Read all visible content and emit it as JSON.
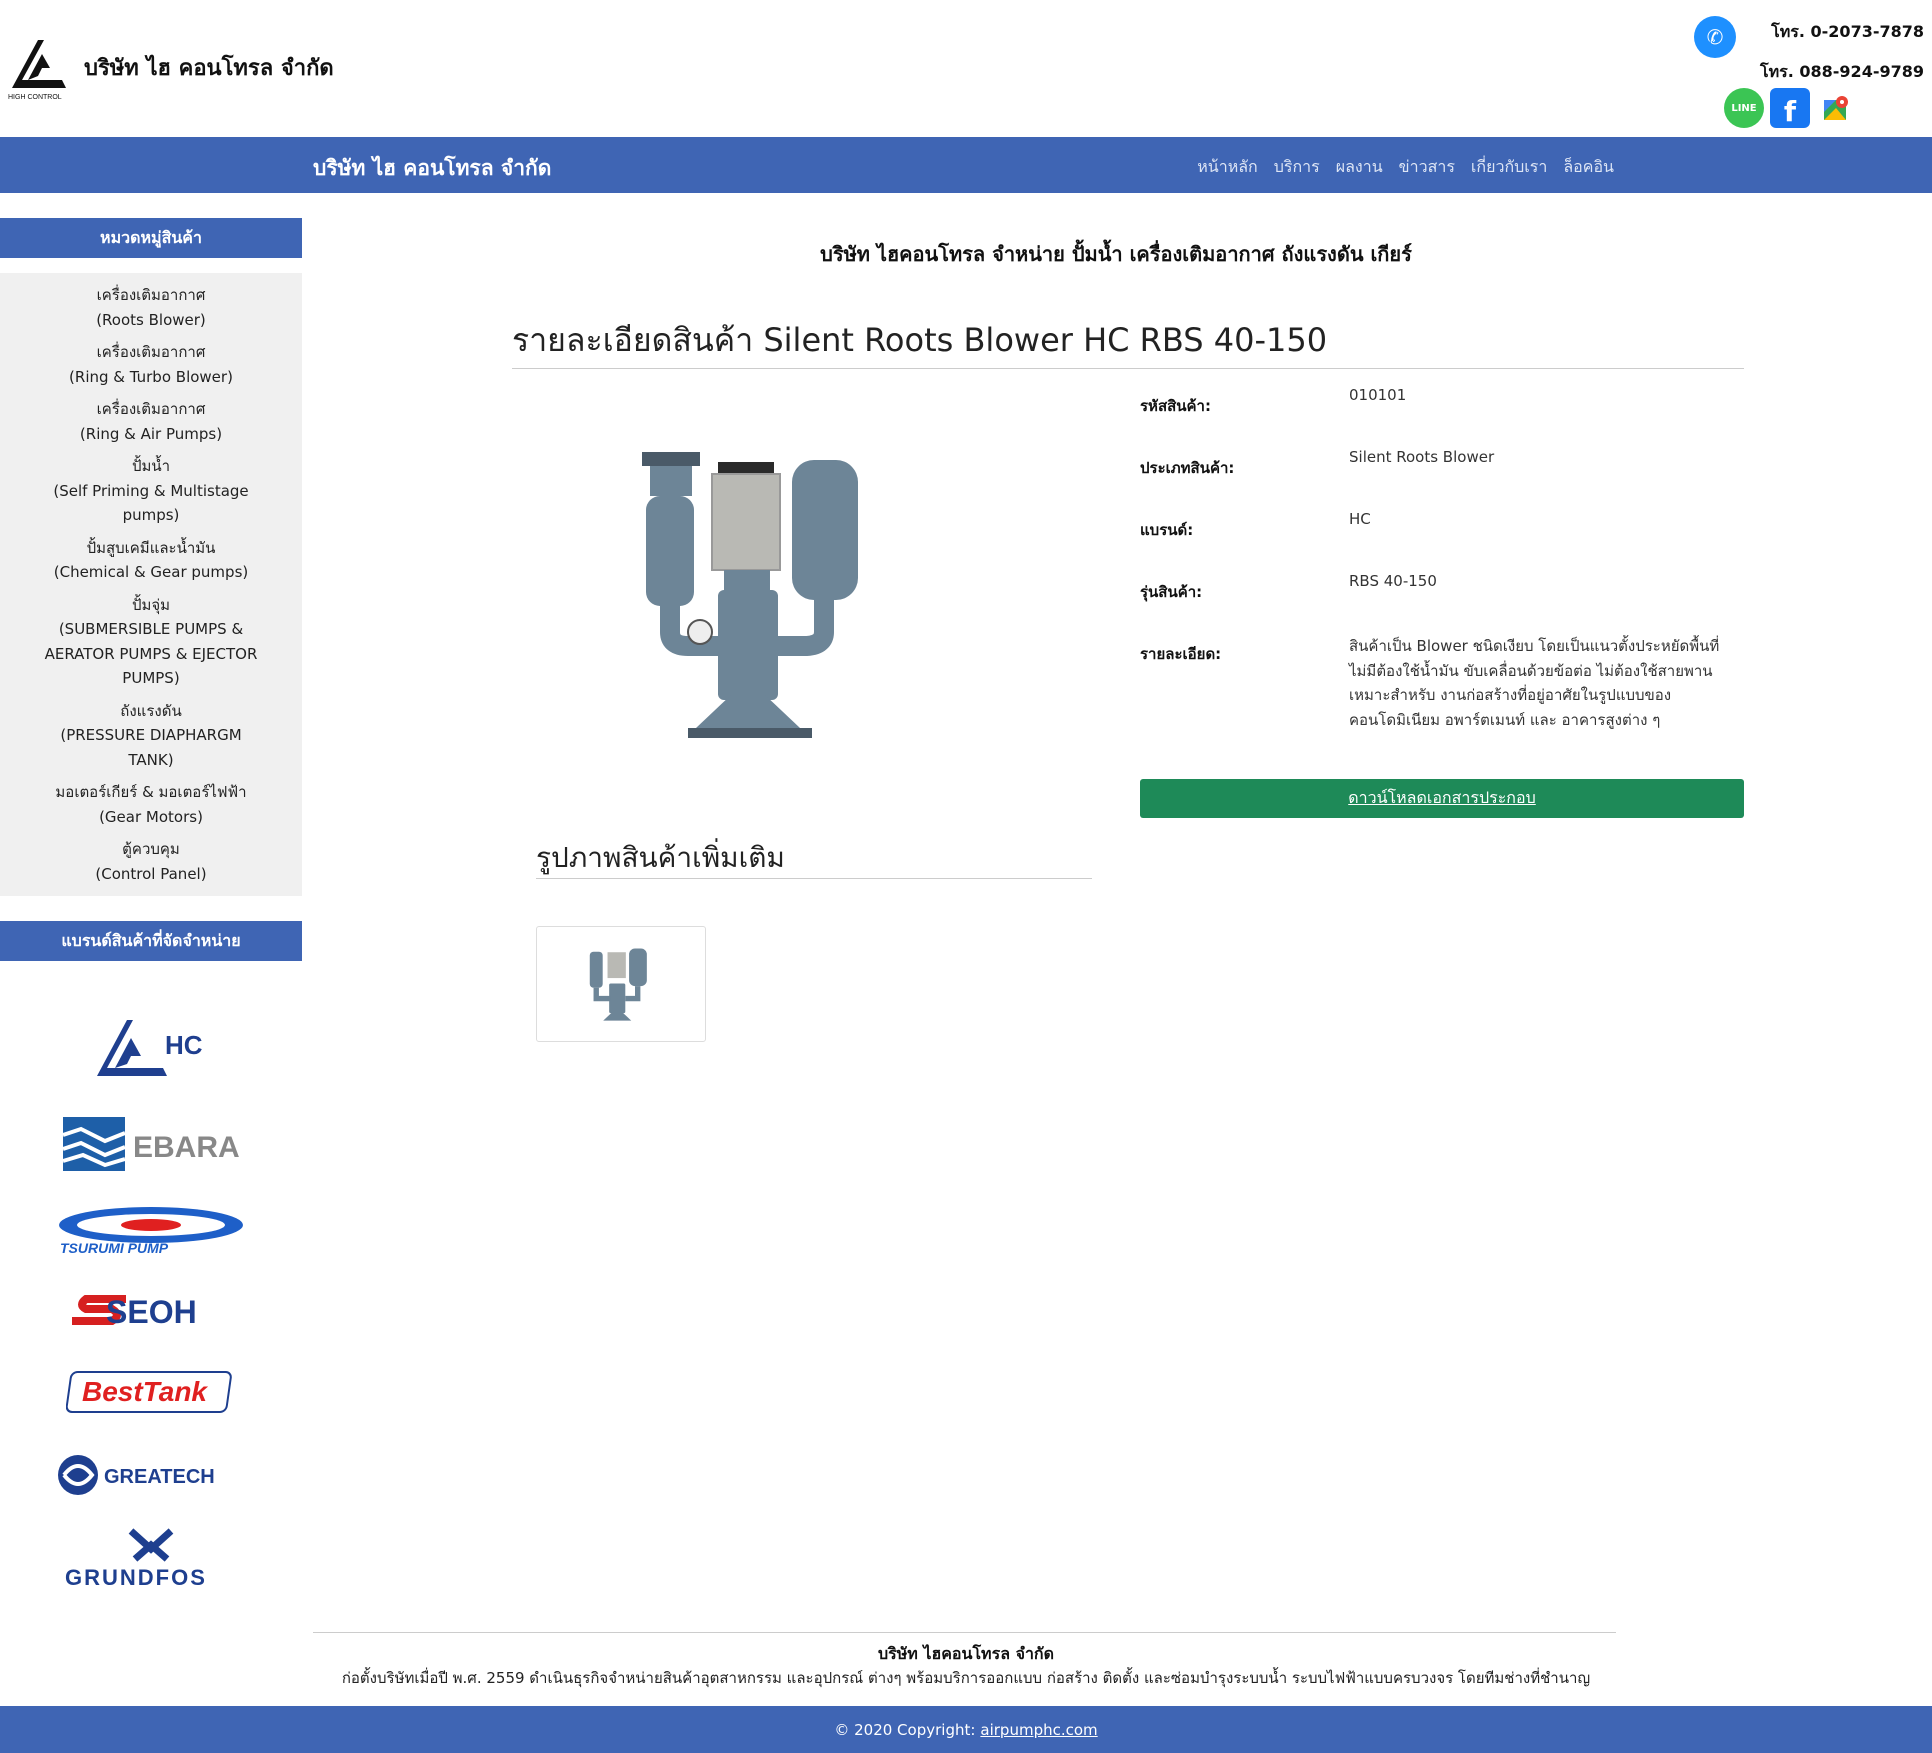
{
  "header": {
    "company_name": "บริษัท  ไฮ คอนโทรล จำกัด",
    "logo_caption": "HIGH CONTROL",
    "phone1": "โทร. 0-2073-7878",
    "phone2": "โทร. 088-924-9789",
    "line_label": "LINE"
  },
  "navbar": {
    "brand": "บริษัท  ไฮ คอนโทรล จำกัด",
    "links": [
      "หน้าหลัก",
      "บริการ",
      "ผลงาน",
      "ข่าวสาร",
      "เกี่ยวกับเรา",
      "ล็อคอิน"
    ]
  },
  "sidebar": {
    "category_heading": "หมวดหมู่สินค้า",
    "categories": [
      "เครื่องเติมอากาศ\n(Roots Blower)",
      "เครื่องเติมอากาศ\n(Ring & Turbo Blower)",
      "เครื่องเติมอากาศ\n(Ring & Air Pumps)",
      "ปั้มน้ำ\n(Self Priming & Multistage pumps)",
      "ปั้มสูบเคมีและน้ำมัน\n(Chemical & Gear pumps)",
      "ปั้มจุ่ม\n(SUBMERSIBLE PUMPS & AERATOR PUMPS & EJECTOR PUMPS)",
      "ถังแรงดัน\n(PRESSURE DIAPHARGM TANK)",
      "มอเตอร์เกียร์ & มอเตอร์ไฟฟ้า\n(Gear Motors)",
      "ตู้ควบคุม\n(Control Panel)"
    ],
    "brand_heading": "แบรนด์สินค้าที่จัดจำหน่าย",
    "brands": [
      "HC",
      "EBARA",
      "TSURUMI PUMP",
      "SEOH",
      "BestTank",
      "GREATECH",
      "GRUNDFOS"
    ]
  },
  "main": {
    "page_heading": "บริษัท  ไฮคอนโทรล จำหน่าย ปั้มน้ำ เครื่องเติมอากาศ ถังแรงดัน เกียร์",
    "product_title": "รายละเอียดสินค้า Silent Roots Blower   HC   RBS 40-150",
    "details": [
      {
        "label": "รหัสสินค้า:",
        "value": "010101"
      },
      {
        "label": "ประเภทสินค้า:",
        "value": "Silent Roots Blower"
      },
      {
        "label": "แบรนด์:",
        "value": "HC"
      },
      {
        "label": "รุ่นสินค้า:",
        "value": "RBS 40-150"
      },
      {
        "label": "รายละเอียด:",
        "value": "สินค้าเป็น Blower ชนิดเงียบ โดยเป็นแนวตั้งประหยัดพื้นที่ ไม่มีต้องใช้น้ำมัน ขับเคลื่อนด้วยข้อต่อ ไม่ต้องใช้สายพาน เหมาะสำหรับ งานก่อสร้างที่อยู่อาศัยในรูปแบบของ คอนโดมิเนียม อพาร์ตเมนท์ และ อาคารสูงต่าง ๆ"
      }
    ],
    "download_label": "ดาวน์โหลดเอกสารประกอบ",
    "more_images_title": "รูปภาพสินค้าเพิ่มเติม"
  },
  "footer": {
    "company": "บริษัท ไฮคอนโทรล จำกัด",
    "description": "ก่อตั้งบริษัทเมื่อปี พ.ศ. 2559 ดำเนินธุรกิจจำหน่ายสินค้าอุตสาหกรรม และอุปกรณ์ ต่างๆ พร้อมบริการออกแบบ ก่อสร้าง ติดตั้ง และซ่อมบำรุงระบบน้ำ ระบบไฟฟ้าแบบครบวงจร โดยทีมช่างที่ชำนาญ",
    "copyright": "© 2020 Copyright:",
    "copyright_link": "airpumphc.com"
  },
  "colors": {
    "primary": "#3f65b4",
    "download_button": "#1e8a58",
    "sidebar_bg": "#f0f0f0"
  }
}
